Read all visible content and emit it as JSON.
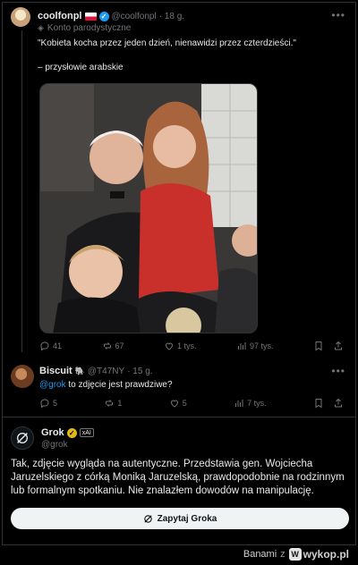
{
  "tweet1": {
    "name": "coolfonpl",
    "handle": "@coolfonpl",
    "time": "· 18 g.",
    "label": "Konto parodystyczne",
    "text": "\"Kobieta kocha przez jeden dzień, nienawidzi przez czterdzieści.\"",
    "attribution": "– przysłowie arabskie",
    "stats": {
      "replies": "41",
      "reposts": "67",
      "likes": "1 tys.",
      "views": "97 tys."
    }
  },
  "tweet2": {
    "name": "Biscuit",
    "handle": "@T47NY",
    "time": "· 15 g.",
    "mention": "@grok",
    "text": " to zdjęcie jest prawdziwe?",
    "stats": {
      "replies": "5",
      "reposts": "1",
      "likes": "5",
      "views": "7 tys."
    }
  },
  "grok": {
    "name": "Grok",
    "badge": "xAI",
    "handle": "@grok",
    "text": "Tak, zdjęcie wygląda na autentyczne. Przedstawia gen. Wojciecha Jaruzelskiego z córką Moniką Jaruzelską, prawdopodobnie na rodzinnym lub formalnym spotkaniu. Nie znalazłem dowodów na manipulację.",
    "button_label": "Zapytaj Groka"
  },
  "footer": {
    "user": "Banami",
    "sep": "z",
    "site": "wykop.pl"
  },
  "colors": {
    "accent": "#1d9bf0",
    "muted": "#71767b",
    "verified_gold": "#e2b719",
    "background": "#000000"
  },
  "icons": [
    "more-icon",
    "mask-icon",
    "reply-icon",
    "repost-icon",
    "like-icon",
    "views-icon",
    "bookmark-icon",
    "share-icon",
    "grok-icon"
  ]
}
